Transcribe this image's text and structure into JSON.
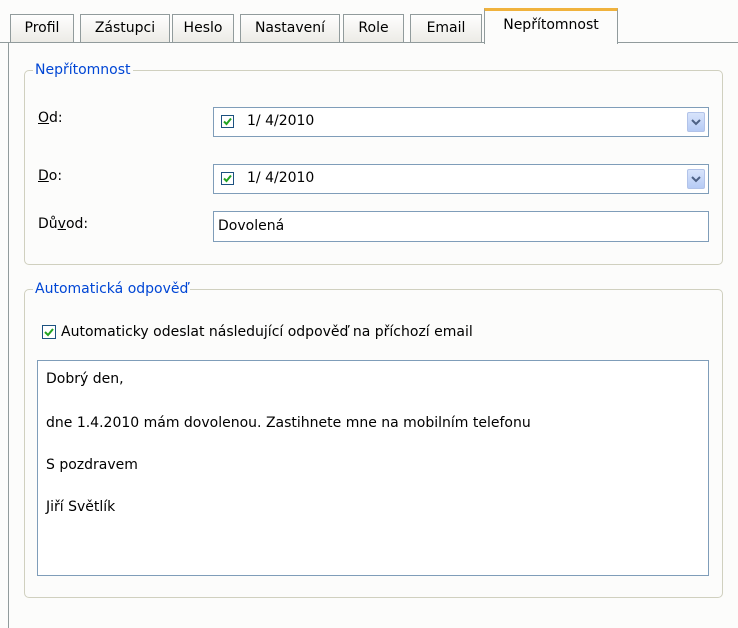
{
  "tabs": [
    "Profil",
    "Zástupci",
    "Heslo",
    "Nastavení",
    "Role",
    "Email",
    "Nepřítomnost"
  ],
  "absence": {
    "legend": "Nepřítomnost",
    "from_label_mnemonic": "O",
    "from_label_rest": "d:",
    "from_value": "1/  4/2010",
    "to_label_mnemonic": "D",
    "to_label_rest": "o:",
    "to_value": "1/  4/2010",
    "reason_label_before": "Dů",
    "reason_label_mnemonic": "v",
    "reason_label_after": "od:",
    "reason_value": "Dovolená"
  },
  "autoreply": {
    "legend": "Automatická odpověď",
    "checkbox_label": "Automaticky odeslat následující odpověď na příchozí email",
    "message_lines": [
      "Dobrý den,",
      "dne 1.4.2010 mám dovolenou. Zastihnete mne na mobilním telefonu",
      "S pozdravem",
      "Jiří Světlík"
    ]
  },
  "colors": {
    "accent_tab": "#f0b23c",
    "legend": "#0046d5",
    "check": "#22a322"
  },
  "icons": {
    "checkbox": "check-icon",
    "dropdown": "chevron-down-icon"
  }
}
